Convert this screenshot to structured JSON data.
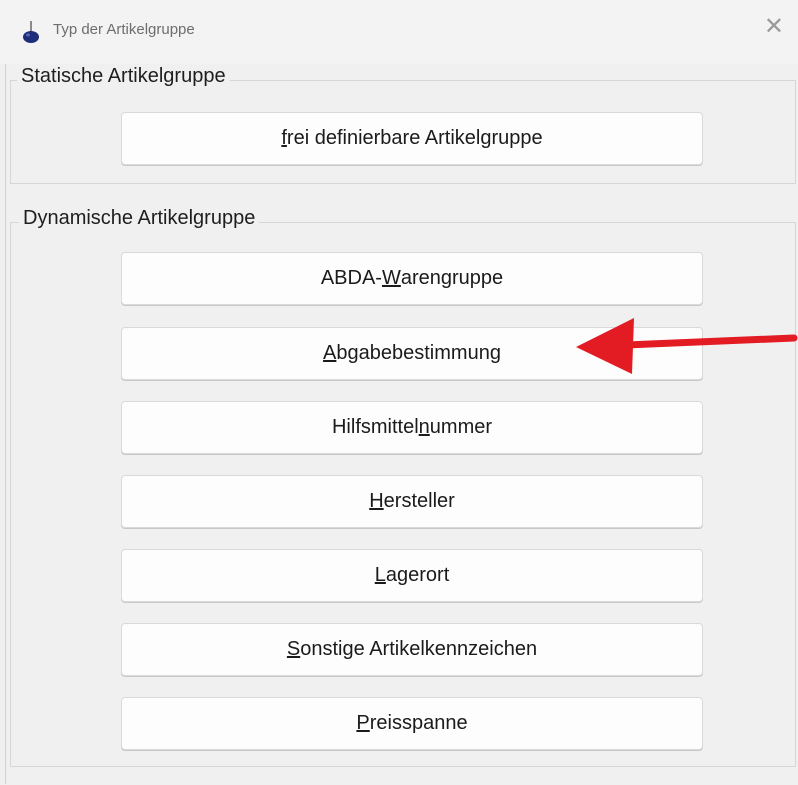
{
  "window": {
    "title": "Typ der Artikelgruppe",
    "close_symbol": "✕",
    "icon": "flask-icon"
  },
  "static_group": {
    "legend": "Statische Artikelgruppe",
    "buttons": [
      {
        "pre": "",
        "accel": "f",
        "post": "rei definierbare Artikelgruppe"
      }
    ]
  },
  "dynamic_group": {
    "legend": "Dynamische Artikelgruppe",
    "buttons": [
      {
        "pre": "ABDA- ",
        "accel": "W",
        "post": "arengruppe"
      },
      {
        "pre": "",
        "accel": "A",
        "post": "bgabebestimmung"
      },
      {
        "pre": "Hilfsmittel",
        "accel": "n",
        "post": "ummer"
      },
      {
        "pre": "",
        "accel": "H",
        "post": "ersteller"
      },
      {
        "pre": "",
        "accel": "L",
        "post": "agerort"
      },
      {
        "pre": "",
        "accel": "S",
        "post": "onstige Artikelkennzeichen"
      },
      {
        "pre": "",
        "accel": "P",
        "post": "reisspanne"
      }
    ]
  },
  "annotation": {
    "arrow_color": "#e31b23",
    "points_to": "Abgabebestimmung"
  }
}
